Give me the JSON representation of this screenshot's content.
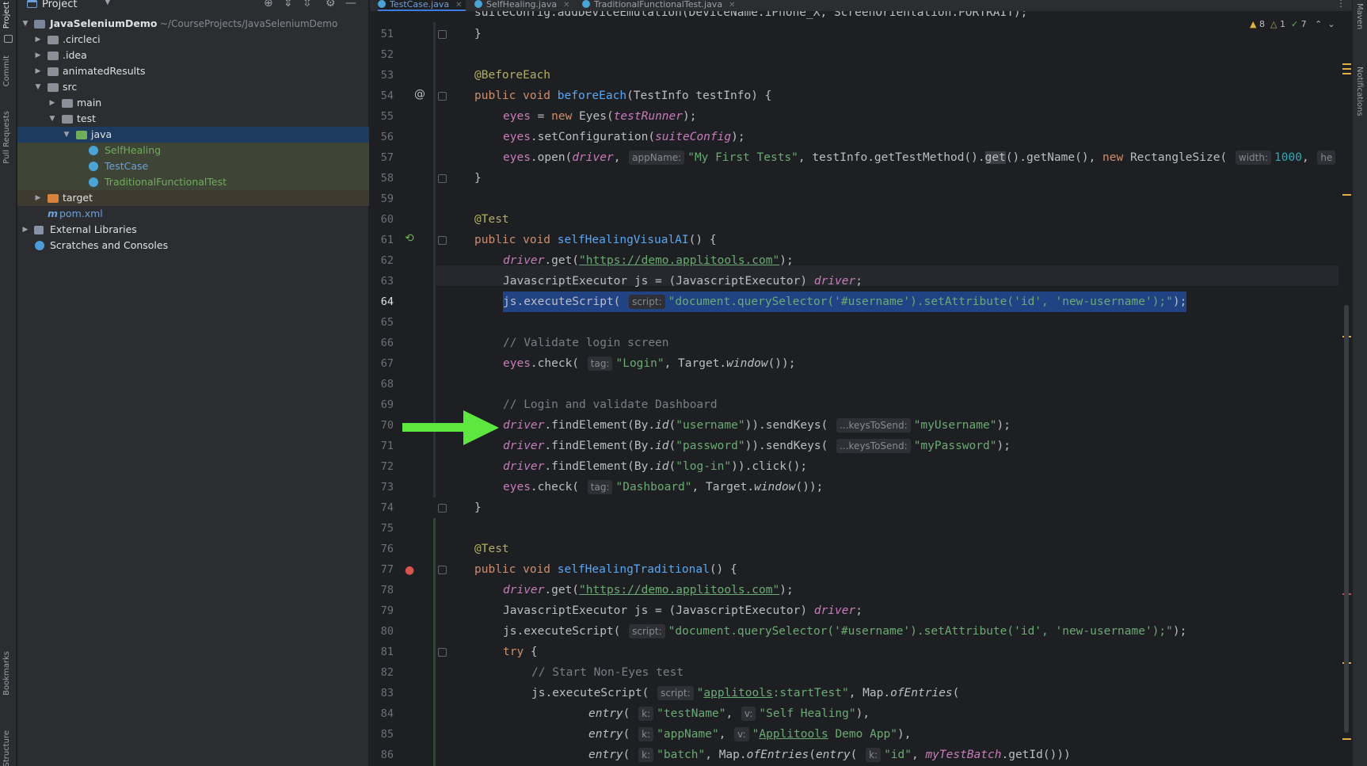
{
  "tool_strip": {
    "project": "Project",
    "commit": "Commit",
    "pull_requests": "Pull Requests",
    "bookmarks": "Bookmarks",
    "structure": "Structure"
  },
  "right_strip": {
    "maven": "Maven",
    "notifications": "Notifications"
  },
  "project_panel": {
    "title": "Project",
    "tree": [
      {
        "label": "JavaSeleniumDemo",
        "path": "~/CourseProjects/JavaSeleniumDemo"
      },
      {
        "label": ".circleci"
      },
      {
        "label": ".idea"
      },
      {
        "label": "animatedResults"
      },
      {
        "label": "src"
      },
      {
        "label": "main"
      },
      {
        "label": "test"
      },
      {
        "label": "java"
      },
      {
        "label": "SelfHealing"
      },
      {
        "label": "TestCase"
      },
      {
        "label": "TraditionalFunctionalTest"
      },
      {
        "label": "target"
      },
      {
        "label": "pom.xml"
      },
      {
        "label": "External Libraries"
      },
      {
        "label": "Scratches and Consoles"
      }
    ]
  },
  "editor_tabs": [
    {
      "label": "TestCase.java"
    },
    {
      "label": "SelfHealing.java"
    },
    {
      "label": "TraditionalFunctionalTest.java"
    }
  ],
  "inspections": {
    "warnings": "8",
    "weak_warnings": "1",
    "ok": "7"
  },
  "gutter_marks": {
    "override": "@"
  },
  "line_numbers": [
    "51",
    "52",
    "53",
    "54",
    "55",
    "56",
    "57",
    "58",
    "59",
    "60",
    "61",
    "62",
    "63",
    "64",
    "65",
    "66",
    "67",
    "68",
    "69",
    "70",
    "71",
    "72",
    "73",
    "74",
    "75",
    "76",
    "77",
    "78",
    "79",
    "80",
    "81",
    "82",
    "83",
    "84",
    "85",
    "86"
  ],
  "code": {
    "l50": "suiteConfig.addDeviceEmulation(DeviceName.iPhone_X, ScreenOrientation.PORTRAIT);",
    "l51": "}",
    "l53": "@BeforeEach",
    "l54": [
      "public void ",
      "beforeEach",
      "(TestInfo testInfo) {"
    ],
    "l55": [
      "eyes",
      " = ",
      "new ",
      "Eyes(",
      "testRunner",
      ");"
    ],
    "l56": [
      "eyes",
      ".setConfiguration(",
      "suiteConfig",
      ");"
    ],
    "l57": [
      "eyes",
      ".open(",
      "driver",
      ", ",
      "appName:",
      "\"My First Tests\"",
      ", testInfo.getTestMethod().",
      "get",
      "().getName(), ",
      "new ",
      "RectangleSize( ",
      "width:",
      "1000",
      ", ",
      "he"
    ],
    "l58": "}",
    "l60": "@Test",
    "l61": [
      "public void ",
      "selfHealingVisualAI",
      "() {"
    ],
    "l62": [
      "driver",
      ".get(",
      "\"https://demo.applitools.com\"",
      ");"
    ],
    "l63": [
      "JavascriptExecutor js = (JavascriptExecutor) ",
      "driver",
      ";"
    ],
    "l64": [
      "js.executeScript( ",
      "script:",
      "\"document.querySelector('#username').setAttribute('id', 'new-username');\"",
      ");"
    ],
    "l66": "// Validate login screen",
    "l67": [
      "eyes",
      ".check( ",
      "tag:",
      "\"Login\"",
      ", Target.",
      "window",
      "());"
    ],
    "l69": "// Login and validate Dashboard",
    "l70": [
      "driver",
      ".findElement(By.",
      "id",
      "(",
      "\"username\"",
      ")).sendKeys( ",
      "...keysToSend:",
      "\"myUsername\"",
      ");"
    ],
    "l71": [
      "driver",
      ".findElement(By.",
      "id",
      "(",
      "\"password\"",
      ")).sendKeys( ",
      "...keysToSend:",
      "\"myPassword\"",
      ");"
    ],
    "l72": [
      "driver",
      ".findElement(By.",
      "id",
      "(",
      "\"log-in\"",
      ")).click();"
    ],
    "l73": [
      "eyes",
      ".check( ",
      "tag:",
      "\"Dashboard\"",
      ", Target.",
      "window",
      "());"
    ],
    "l74": "}",
    "l76": "@Test",
    "l77": [
      "public void ",
      "selfHealingTraditional",
      "() {"
    ],
    "l78": [
      "driver",
      ".get(",
      "\"https://demo.applitools.com\"",
      ");"
    ],
    "l79": [
      "JavascriptExecutor js = (JavascriptExecutor) ",
      "driver",
      ";"
    ],
    "l80": [
      "js.executeScript( ",
      "script:",
      "\"document.querySelector('#username').setAttribute('id', 'new-username');\"",
      ");"
    ],
    "l81": [
      "try",
      " {"
    ],
    "l82": "// Start Non-Eyes test",
    "l83": [
      "js.executeScript( ",
      "script:",
      "\"",
      "applitools",
      ":startTest\"",
      ", Map.",
      "ofEntries",
      "("
    ],
    "l84": [
      "entry",
      "( ",
      "k:",
      "\"testName\"",
      ", ",
      "v:",
      "\"Self Healing\"",
      "),"
    ],
    "l85": [
      "entry",
      "( ",
      "k:",
      "\"appName\"",
      ", ",
      "v:",
      "\"",
      "Applitools",
      " Demo App\"",
      "),"
    ],
    "l86": [
      "entry",
      "( ",
      "k:",
      "\"batch\"",
      ", Map.",
      "ofEntries",
      "(",
      "entry",
      "( ",
      "k:",
      "\"id\"",
      ", ",
      "myTestBatch",
      ".getId()))"
    ]
  },
  "colors": {
    "accent_arrow": "#5ee83f",
    "selection": "#214283",
    "keyword": "#cf8e6d",
    "string": "#6aab73",
    "annotation": "#b3ae60",
    "method": "#56a8f5"
  }
}
